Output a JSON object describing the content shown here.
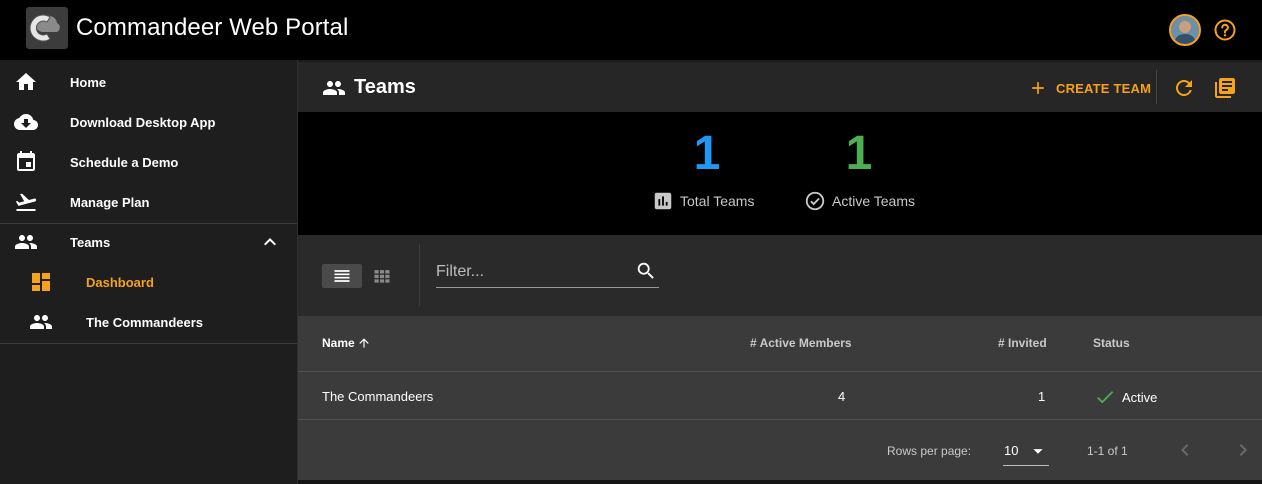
{
  "app": {
    "title": "Commandeer Web Portal",
    "accent_color": "#f7a21b"
  },
  "sidebar": {
    "items": [
      {
        "label": "Home",
        "icon": "home-icon"
      },
      {
        "label": "Download Desktop App",
        "icon": "cloud-download-icon"
      },
      {
        "label": "Schedule a Demo",
        "icon": "calendar-icon"
      },
      {
        "label": "Manage Plan",
        "icon": "flight-takeoff-icon"
      }
    ],
    "teams": {
      "label": "Teams",
      "icon": "people-icon",
      "expanded": true,
      "children": [
        {
          "label": "Dashboard",
          "icon": "dashboard-icon",
          "active": true
        },
        {
          "label": "The Commandeers",
          "icon": "people-icon"
        }
      ]
    }
  },
  "header": {
    "title": "Teams",
    "create_label": "CREATE TEAM"
  },
  "stats": {
    "total": {
      "value": "1",
      "label": "Total Teams",
      "color": "#2196f3"
    },
    "active": {
      "value": "1",
      "label": "Active Teams",
      "color": "#4caf50"
    }
  },
  "toolbar": {
    "filter_placeholder": "Filter...",
    "view_mode": "list"
  },
  "table": {
    "columns": [
      "Name",
      "# Active Members",
      "# Invited",
      "Status"
    ],
    "sort": {
      "column": "Name",
      "direction": "asc"
    },
    "rows": [
      {
        "name": "The Commandeers",
        "active_members": "4",
        "invited": "1",
        "status": "Active"
      }
    ]
  },
  "pagination": {
    "rows_per_page_label": "Rows per page:",
    "rows_per_page": "10",
    "range": "1-1 of 1"
  }
}
